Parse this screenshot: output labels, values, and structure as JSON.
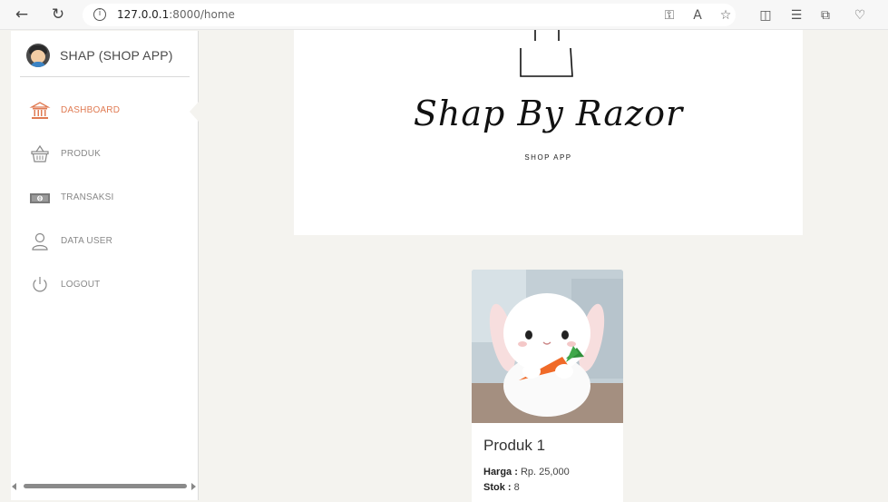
{
  "browser": {
    "url_host": "127.0.0.1",
    "url_path": ":8000/home",
    "back_icon": "arrow-left-icon",
    "reload_icon": "reload-icon",
    "info_icon": "info-icon",
    "info_glyph": "i"
  },
  "sidebar": {
    "app_title": "SHAP (SHOP APP)",
    "items": [
      {
        "label": "DASHBOARD",
        "icon": "bank-icon",
        "active": true
      },
      {
        "label": "PRODUK",
        "icon": "basket-icon",
        "active": false
      },
      {
        "label": "TRANSAKSI",
        "icon": "cash-icon",
        "active": false
      },
      {
        "label": "DATA USER",
        "icon": "user-icon",
        "active": false
      },
      {
        "label": "LOGOUT",
        "icon": "power-icon",
        "active": false
      }
    ],
    "accent_color": "#e07b53"
  },
  "banner": {
    "logo_text": "Shap By Razor",
    "logo_subtitle": "SHOP APP"
  },
  "products": [
    {
      "name": "Produk 1",
      "price_label": "Harga :",
      "price_value": " Rp. 25,000",
      "stock_label": "Stok :",
      "stock_value": " 8"
    }
  ]
}
